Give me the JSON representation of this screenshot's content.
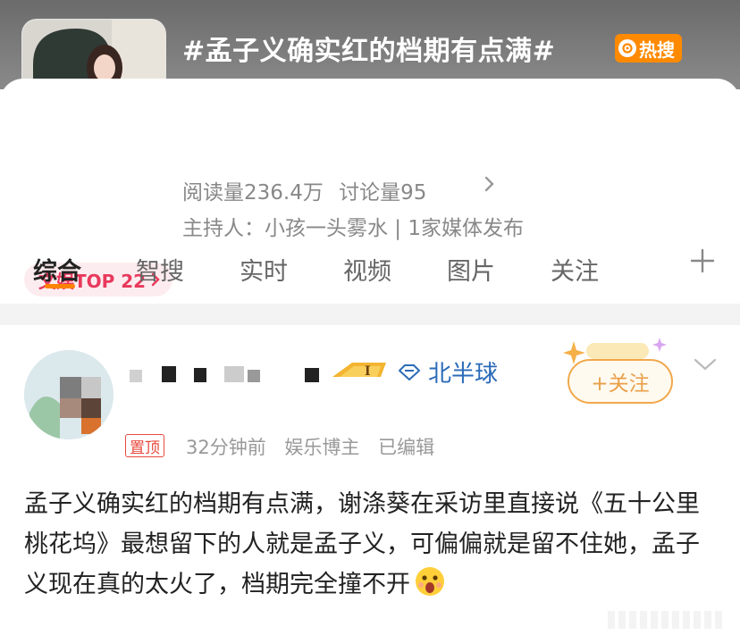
{
  "topic": {
    "title": "#孟子义确实红的档期有点满#",
    "hot_badge": "热搜",
    "read_count": "阅读量236.4万",
    "discuss_count": "讨论量95",
    "host": "主持人：小孩一头雾水 | 1家媒体发布",
    "rank": "文娱TOP 22"
  },
  "tabs": [
    {
      "label": "综合"
    },
    {
      "label": "智搜"
    },
    {
      "label": "实时"
    },
    {
      "label": "视频"
    },
    {
      "label": "图片"
    },
    {
      "label": "关注"
    }
  ],
  "post": {
    "location": "北半球",
    "follow_label": "+关注",
    "pin_label": "置顶",
    "time": "32分钟前",
    "role": "娱乐博主",
    "edited": "已编辑",
    "content": "孟子义确实红的档期有点满，谢涤葵在采访里直接说《五十公里桃花坞》最想留下的人就是孟子义，可偏偏就是留不住她，孟子义现在真的太火了，档期完全撞不开"
  },
  "colors": {
    "accent": "#ff8200",
    "hot": "#ff8a00",
    "rank_text": "#e8395c",
    "link_blue": "#2b6bb8",
    "follow": "#e9a04a",
    "pin_red": "#e8493c"
  }
}
